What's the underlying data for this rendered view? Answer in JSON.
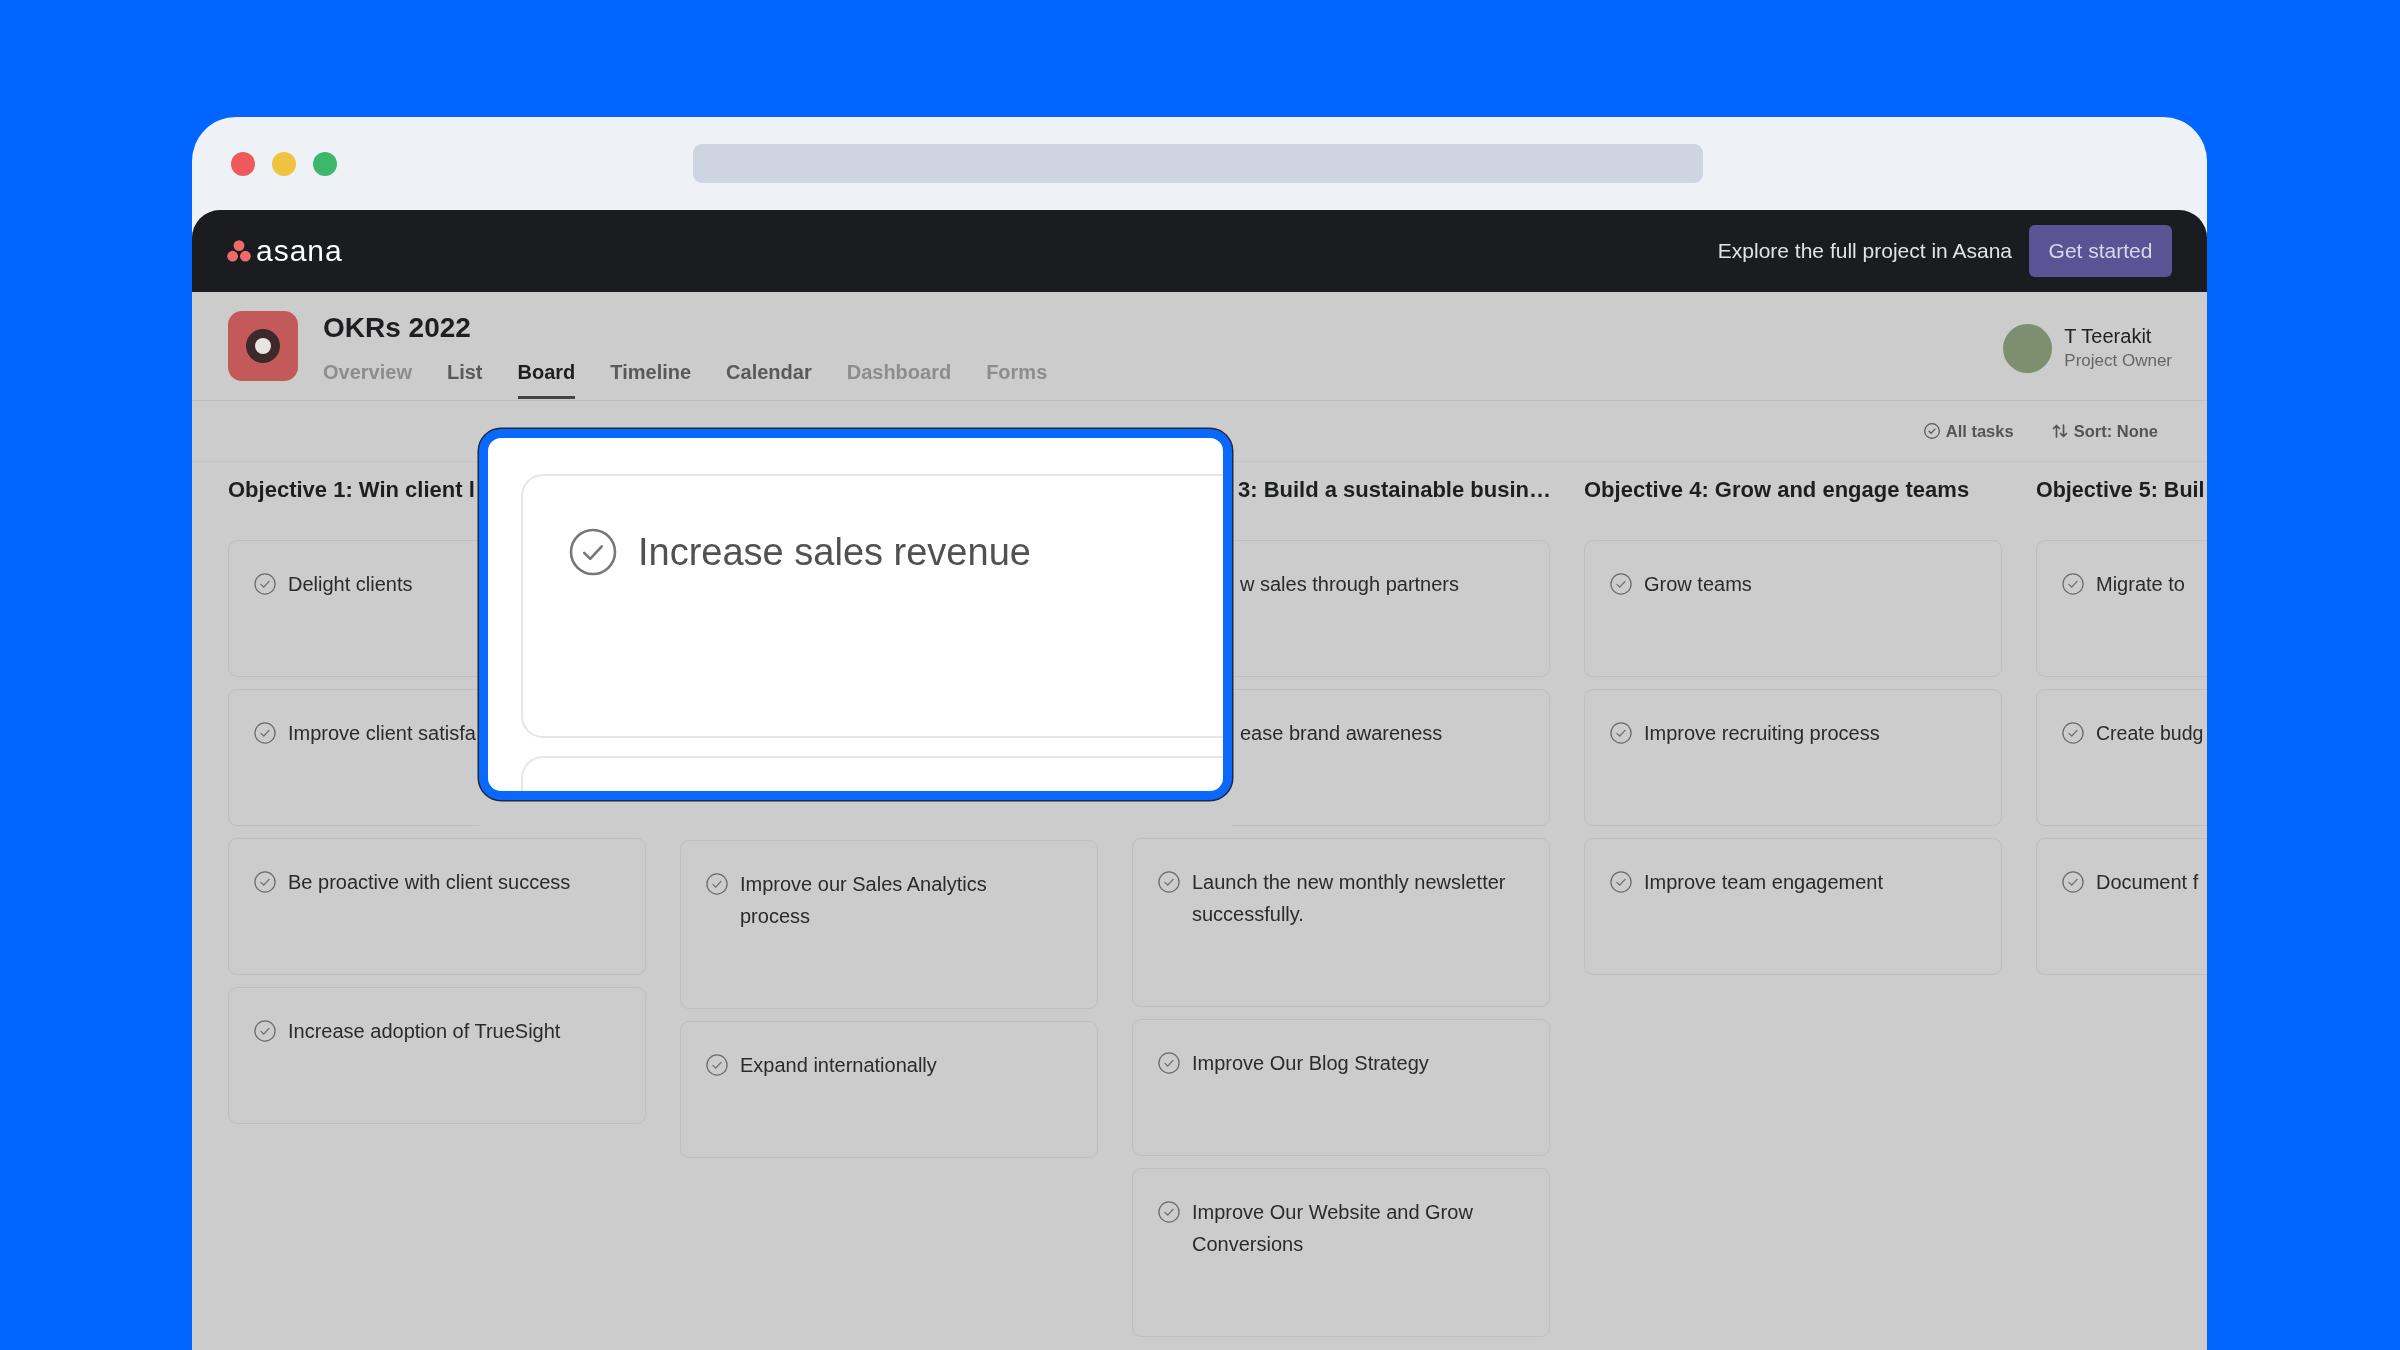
{
  "topbar": {
    "logo": "asana",
    "promo": "Explore the full project in Asana",
    "cta": "Get started"
  },
  "project": {
    "title": "OKRs 2022",
    "tabs": [
      {
        "label": "Overview",
        "selected": false,
        "disabled": true
      },
      {
        "label": "List",
        "selected": false,
        "disabled": false
      },
      {
        "label": "Board",
        "selected": true,
        "disabled": false
      },
      {
        "label": "Timeline",
        "selected": false,
        "disabled": false
      },
      {
        "label": "Calendar",
        "selected": false,
        "disabled": false
      },
      {
        "label": "Dashboard",
        "selected": false,
        "disabled": true
      },
      {
        "label": "Forms",
        "selected": false,
        "disabled": true
      }
    ],
    "owner": {
      "name": "T Teerakit",
      "role": "Project Owner"
    }
  },
  "toolbar": [
    {
      "kind": "filter",
      "label": "All tasks"
    },
    {
      "kind": "sort",
      "label": "Sort: None"
    }
  ],
  "columns": [
    {
      "heading": "Objective 1: Win client l",
      "cards": [
        {
          "title": "Delight clients"
        },
        {
          "title": "Improve client satisfa"
        },
        {
          "title": "Be proactive with client success"
        },
        {
          "title": "Increase adoption of TrueSight"
        }
      ]
    },
    {
      "cards": [
        {
          "title": "Improve our Sales Analytics process"
        },
        {
          "title": "Expand internationally"
        }
      ]
    },
    {
      "heading": "3: Build a sustainable busin…",
      "cards": [
        {
          "title": "w sales through partners"
        },
        {
          "title": "ease brand awareness"
        },
        {
          "title": "Launch the new monthly newsletter successfully."
        },
        {
          "title": "Improve Our Blog Strategy"
        },
        {
          "title": "Improve Our Website and Grow Conversions"
        }
      ]
    },
    {
      "heading": "Objective 4: Grow and engage teams",
      "cards": [
        {
          "title": "Grow teams"
        },
        {
          "title": "Improve recruiting process"
        },
        {
          "title": "Improve team engagement"
        }
      ]
    },
    {
      "heading": "Objective 5: Buil",
      "cards": [
        {
          "title": "Migrate to"
        },
        {
          "title": "Create budg"
        },
        {
          "title": "Document f"
        }
      ]
    }
  ],
  "callout": {
    "title": "Increase sales revenue"
  }
}
